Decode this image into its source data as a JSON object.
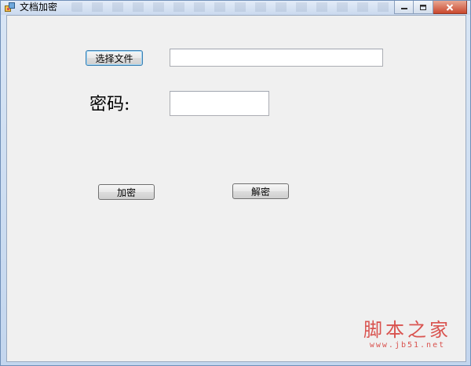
{
  "window": {
    "title": "文档加密"
  },
  "form": {
    "choose_file_button": "选择文件",
    "file_path_value": "",
    "password_label": "密码:",
    "password_value": "",
    "encrypt_button": "加密",
    "decrypt_button": "解密"
  },
  "watermark": {
    "name": "脚本之家",
    "url": "www.jb51.net"
  },
  "icons": {
    "app": "app-icon",
    "minimize": "minimize-icon",
    "maximize": "maximize-icon",
    "close": "close-icon"
  },
  "colors": {
    "client_bg": "#f0f0f0",
    "watermark": "#d9534f",
    "close_button": "#c9472d"
  }
}
